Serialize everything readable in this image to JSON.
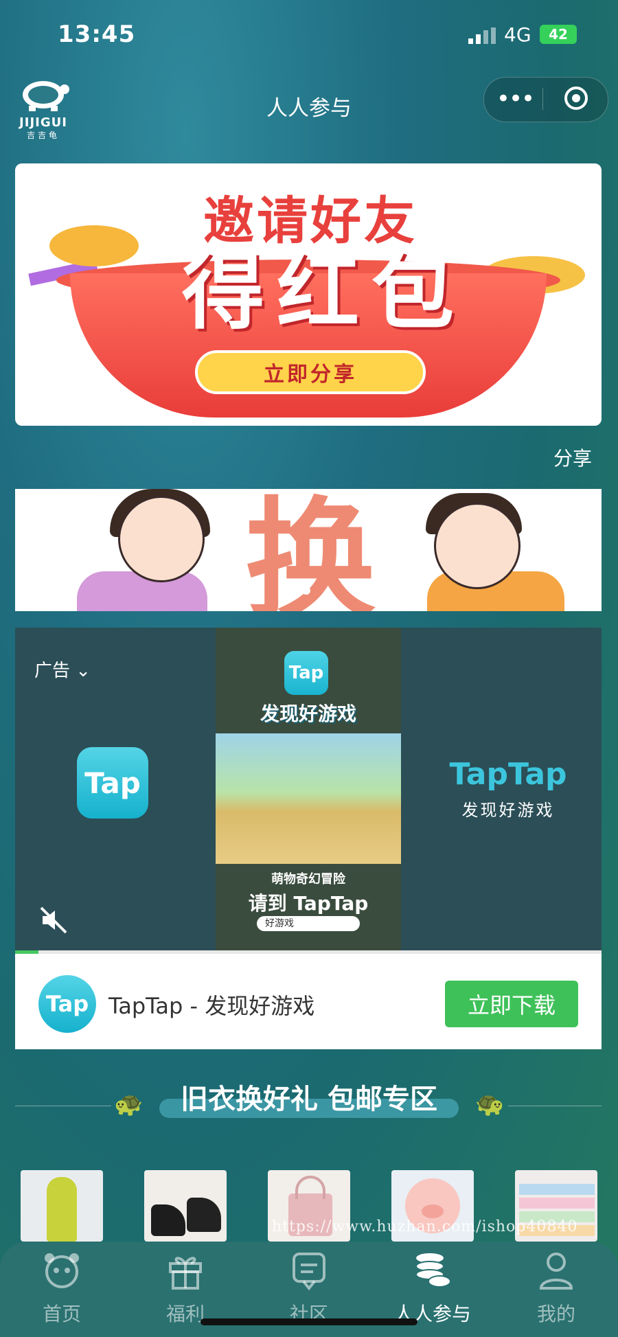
{
  "status_bar": {
    "time": "13:45",
    "network": "4G",
    "battery": "42"
  },
  "nav": {
    "logo_text": "JIJIGUI",
    "logo_sub": "吉吉龟",
    "title": "人人参与"
  },
  "banner": {
    "line1": "邀请好友",
    "line2": "得红包",
    "cta": "立即分享"
  },
  "share_label": "分享",
  "banner2": {
    "big_text": "换"
  },
  "ad": {
    "label": "广告",
    "icon_text": "Tap",
    "video_top_text": "发现好游戏",
    "game_title": "萌物奇幻冒险",
    "please_text": "请到 TapTap",
    "search_text": "好游戏",
    "brand": "TapTap",
    "slogan": "发现好游戏",
    "row_title": "TapTap - 发现好游戏",
    "download": "立即下载",
    "progress": 0.04
  },
  "section": {
    "title": "旧衣换好礼 包邮专区"
  },
  "watermark": "https://www.huzhan.com/ishop40840",
  "tabs": [
    {
      "label": "首页",
      "icon": "panda-icon",
      "active": false
    },
    {
      "label": "福利",
      "icon": "gift-icon",
      "active": false
    },
    {
      "label": "社区",
      "icon": "chat-icon",
      "active": false
    },
    {
      "label": "人人参与",
      "icon": "coins-icon",
      "active": true
    },
    {
      "label": "我的",
      "icon": "user-icon",
      "active": false
    }
  ],
  "colors": {
    "accent_green": "#3fc159",
    "tap_blue": "#1ab4cf",
    "banner_red": "#e8403c"
  }
}
